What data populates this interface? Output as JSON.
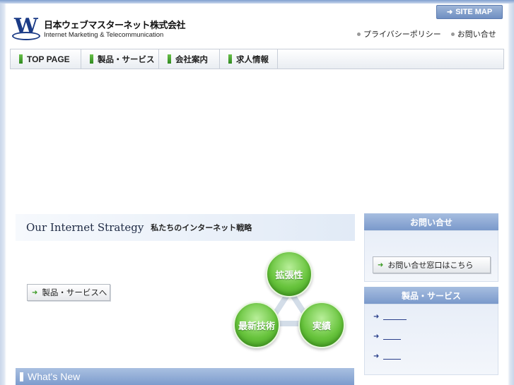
{
  "header": {
    "logo_letter": "W",
    "company_jp": "日本ウェブマスターネット株式会社",
    "company_en": "Internet Marketing & Telecommunication",
    "sitemap_label": "SITE MAP",
    "util_links": [
      "プライバシーポリシー",
      "お問い合せ"
    ]
  },
  "nav": {
    "items": [
      {
        "label": "TOP PAGE"
      },
      {
        "label": "製品・サービス"
      },
      {
        "label": "会社案内"
      },
      {
        "label": "求人情報"
      }
    ]
  },
  "strategy": {
    "title_en": "Our Internet Strategy",
    "title_jp": "私たちのインターネット戦略",
    "button_label": "製品・サービスへ",
    "circles": [
      "拡張性",
      "最新技術",
      "実績"
    ]
  },
  "whatsnew": {
    "title": "What's New"
  },
  "sidebar": {
    "contact_title": "お問い合せ",
    "contact_button": "お問い合せ窓口はこちら",
    "products_title": "製品・サービス"
  },
  "colors": {
    "accent_blue": "#7a99cb",
    "nav_green": "#2f8a1f",
    "link_blue": "#2a3f8a"
  }
}
